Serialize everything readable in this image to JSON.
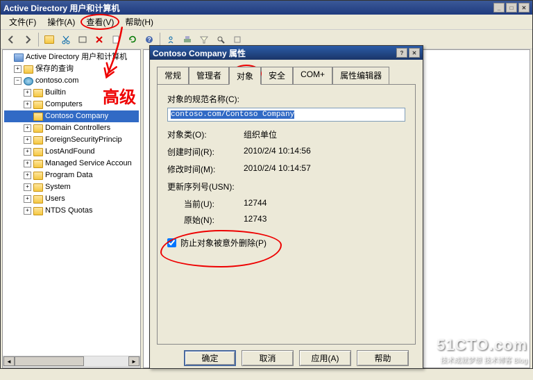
{
  "window": {
    "title": "Active Directory 用户和计算机"
  },
  "menu": {
    "file": "文件(F)",
    "action": "操作(A)",
    "view": "查看(V)",
    "help": "帮助(H)"
  },
  "tree": {
    "root": "Active Directory 用户和计算机",
    "saved_queries": "保存的查询",
    "domain": "contoso.com",
    "items": [
      "Builtin",
      "Computers",
      "Contoso Company",
      "Domain Controllers",
      "ForeignSecurityPrincip",
      "LostAndFound",
      "Managed Service Accoun",
      "Program Data",
      "System",
      "Users",
      "NTDS Quotas"
    ]
  },
  "dialog": {
    "title": "Contoso Company 属性",
    "tabs": {
      "general": "常规",
      "managed_by": "管理者",
      "object": "对象",
      "security": "安全",
      "com": "COM+",
      "attr_editor": "属性编辑器"
    },
    "canonical_label": "对象的规范名称(C):",
    "canonical_value": "contoso.com/Contoso Company",
    "object_class_label": "对象类(O):",
    "object_class_value": "组织单位",
    "created_label": "创建时间(R):",
    "created_value": "2010/2/4 10:14:56",
    "modified_label": "修改时间(M):",
    "modified_value": "2010/2/4 10:14:57",
    "usn_label": "更新序列号(USN):",
    "current_label": "当前(U):",
    "current_value": "12744",
    "original_label": "原始(N):",
    "original_value": "12743",
    "protect_label": "防止对象被意外删除(P)",
    "buttons": {
      "ok": "确定",
      "cancel": "取消",
      "apply": "应用(A)",
      "help": "帮助"
    }
  },
  "annotation": {
    "text": "高级"
  },
  "watermark": {
    "big": "51CTO.com",
    "small": "技术成就梦想  技术博客  Blog"
  }
}
